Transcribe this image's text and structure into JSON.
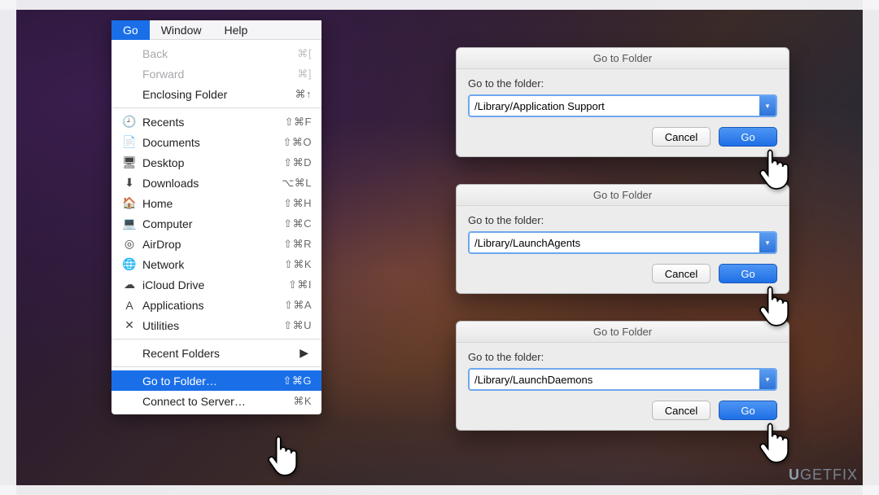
{
  "menubar": {
    "items": [
      {
        "label": "Go",
        "active": true
      },
      {
        "label": "Window",
        "active": false
      },
      {
        "label": "Help",
        "active": false
      }
    ]
  },
  "menu": {
    "nav": [
      {
        "label": "Back",
        "shortcut": "⌘[",
        "disabled": true
      },
      {
        "label": "Forward",
        "shortcut": "⌘]",
        "disabled": true
      },
      {
        "label": "Enclosing Folder",
        "shortcut": "⌘↑",
        "disabled": false
      }
    ],
    "places": [
      {
        "icon": "🕘",
        "label": "Recents",
        "shortcut": "⇧⌘F"
      },
      {
        "icon": "📄",
        "label": "Documents",
        "shortcut": "⇧⌘O"
      },
      {
        "icon": "🖥",
        "label": "Desktop",
        "shortcut": "⇧⌘D"
      },
      {
        "icon": "⬇",
        "label": "Downloads",
        "shortcut": "⌥⌘L"
      },
      {
        "icon": "🏠",
        "label": "Home",
        "shortcut": "⇧⌘H"
      },
      {
        "icon": "💻",
        "label": "Computer",
        "shortcut": "⇧⌘C"
      },
      {
        "icon": "◎",
        "label": "AirDrop",
        "shortcut": "⇧⌘R"
      },
      {
        "icon": "🌐",
        "label": "Network",
        "shortcut": "⇧⌘K"
      },
      {
        "icon": "☁",
        "label": "iCloud Drive",
        "shortcut": "⇧⌘I"
      },
      {
        "icon": "A",
        "label": "Applications",
        "shortcut": "⇧⌘A"
      },
      {
        "icon": "✕",
        "label": "Utilities",
        "shortcut": "⇧⌘U"
      }
    ],
    "recent_label": "Recent Folders",
    "goto": {
      "label": "Go to Folder…",
      "shortcut": "⇧⌘G"
    },
    "connect": {
      "label": "Connect to Server…",
      "shortcut": "⌘K"
    }
  },
  "dialogs": [
    {
      "title": "Go to Folder",
      "prompt": "Go to the folder:",
      "value": "/Library/Application Support",
      "cancel": "Cancel",
      "go": "Go"
    },
    {
      "title": "Go to Folder",
      "prompt": "Go to the folder:",
      "value": "/Library/LaunchAgents",
      "cancel": "Cancel",
      "go": "Go"
    },
    {
      "title": "Go to Folder",
      "prompt": "Go to the folder:",
      "value": "/Library/LaunchDaemons",
      "cancel": "Cancel",
      "go": "Go"
    }
  ],
  "watermark": {
    "a": "U",
    "b": "GETFIX"
  }
}
